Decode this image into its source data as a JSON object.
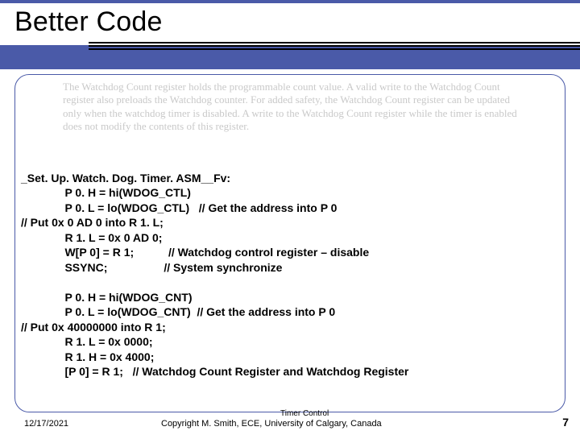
{
  "title": "Better Code",
  "description": "The Watchdog Count register holds the programmable count value. A valid write to the Watchdog Count register also preloads the Watchdog counter. For added safety, the Watchdog Count register can be updated only when the watchdog timer is disabled. A write to the Watchdog Count register while the timer is enabled does not modify the contents of this register.",
  "code": {
    "l1": "_Set. Up. Watch. Dog. Timer. ASM__Fv:",
    "l2": "              P 0. H = hi(WDOG_CTL)",
    "l3": "              P 0. L = lo(WDOG_CTL)   // Get the address into P 0",
    "l4": "// Put 0x 0 AD 0 into R 1. L;",
    "l5": "              R 1. L = 0x 0 AD 0;",
    "l6": "              W[P 0] = R 1;           // Watchdog control register – disable",
    "l7": "              SSYNC;                  // System synchronize",
    "l8": "",
    "l9": "              P 0. H = hi(WDOG_CNT)",
    "l10": "              P 0. L = lo(WDOG_CNT)  // Get the address into P 0",
    "l11": "// Put 0x 40000000 into R 1;",
    "l12": "              R 1. L = 0x 0000;",
    "l13": "              R 1. H = 0x 4000;",
    "l14": "              [P 0] = R 1;   // Watchdog Count Register and Watchdog Register"
  },
  "footer": {
    "date": "12/17/2021",
    "line1": "Timer Control",
    "copyright": "Copyright M. Smith, ECE, University of Calgary, Canada",
    "page": "7"
  }
}
